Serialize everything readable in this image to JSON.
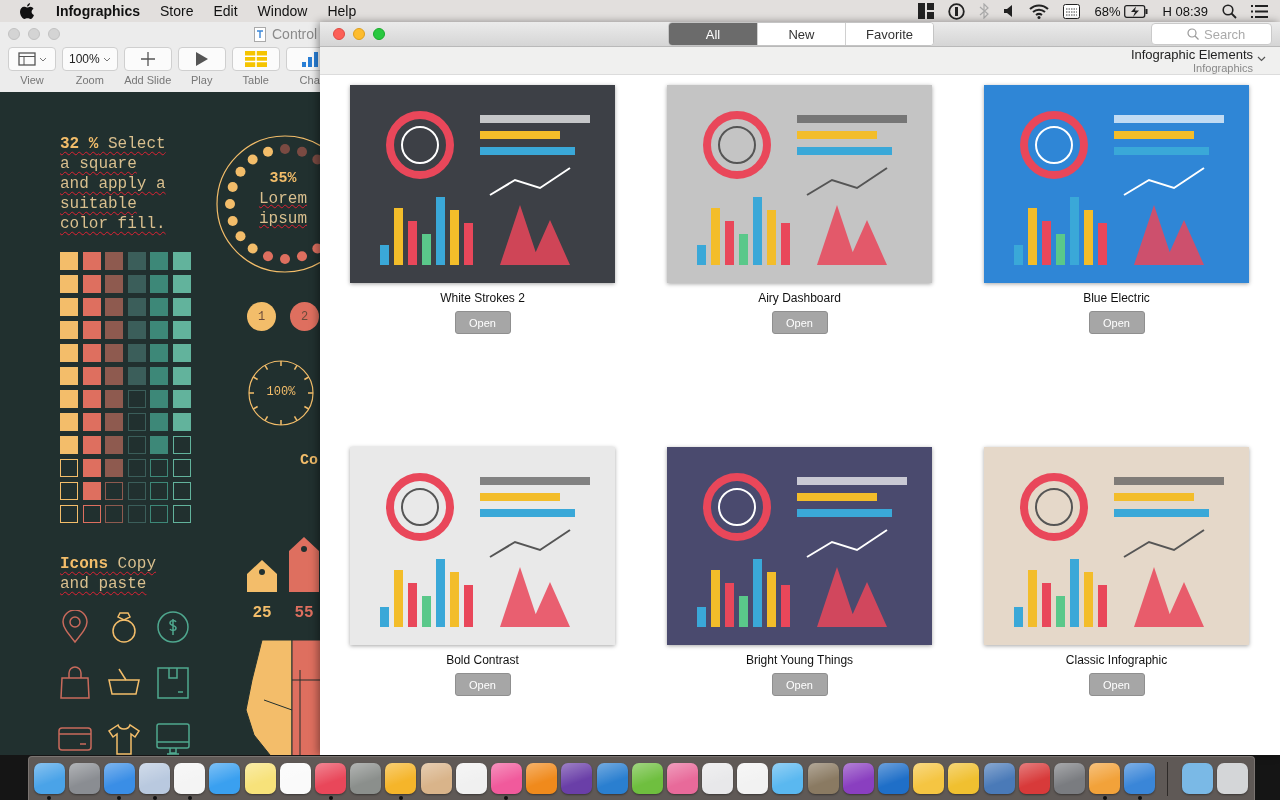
{
  "menu_bar": {
    "app_name": "Infographics",
    "menus": [
      "Store",
      "Edit",
      "Window",
      "Help"
    ],
    "battery_percent": "68%",
    "clock": "H 08:39"
  },
  "document_window": {
    "title": "Control",
    "toolbar": [
      {
        "kind": "view",
        "label": "View"
      },
      {
        "kind": "zoom",
        "label": "Zoom",
        "value": "100%"
      },
      {
        "kind": "add",
        "label": "Add Slide"
      },
      {
        "kind": "play",
        "label": "Play"
      },
      {
        "kind": "table",
        "label": "Table"
      },
      {
        "kind": "chart",
        "label": "Cha"
      }
    ],
    "canvas": {
      "intro": "**32 %** Select a square and apply a suitable color fill.",
      "swatch_columns": [
        {
          "color": "#f3bd6a",
          "level": 0.75
        },
        {
          "color": "#de6f5f",
          "level": 0.917
        },
        {
          "color": "#8e5a4f",
          "level": 0.833
        },
        {
          "color": "#3b5e5a",
          "level": 0.5
        },
        {
          "color": "#3d8878",
          "level": 0.75
        },
        {
          "color": "#62b39c",
          "level": 0.667
        }
      ],
      "icons_heading": "**Icons** Copy and paste",
      "ring_value": "35%",
      "ring_label": "Lorem ipsum",
      "steps": [
        {
          "label": "1",
          "color": "#f3bd6a"
        },
        {
          "label": "2",
          "color": "#de6f5f"
        }
      ],
      "gauge_value": "100%",
      "cut_heading": "Co",
      "tags": [
        {
          "label": "25",
          "color": "#f3bd6a"
        },
        {
          "label": "55",
          "color": "#de6f5f"
        }
      ]
    }
  },
  "template_chooser": {
    "tabs": [
      {
        "label": "All",
        "selected": true
      },
      {
        "label": "New",
        "selected": false
      },
      {
        "label": "Favorite",
        "selected": false
      }
    ],
    "search": {
      "placeholder": "Search"
    },
    "category": {
      "title": "Infographic Elements",
      "subtitle": "Infographics"
    },
    "templates": [
      {
        "name": "White Strokes 2",
        "button": "Open",
        "color": "#3d4046"
      },
      {
        "name": "Airy Dashboard",
        "button": "Open",
        "color": "#c4c4c4"
      },
      {
        "name": "Blue Electric",
        "button": "Open",
        "color": "#2f86d6"
      },
      {
        "name": "Bold Contrast",
        "button": "Open",
        "color": "#e9e9e9"
      },
      {
        "name": "Bright Young Things",
        "button": "Open",
        "color": "#4a4a6e"
      },
      {
        "name": "Classic Infographic",
        "button": "Open",
        "color": "#e5d8c9"
      }
    ]
  },
  "dock": {
    "apps": [
      {
        "color": "#4aa3e8",
        "running": true
      },
      {
        "color": "#8a8d92",
        "running": false
      },
      {
        "color": "#3a8ee6",
        "running": true
      },
      {
        "color": "#b9c9df",
        "running": true
      },
      {
        "color": "#f4f4f4",
        "running": true
      },
      {
        "color": "#3aa0f0",
        "running": false
      },
      {
        "color": "#f7e27a",
        "running": false
      },
      {
        "color": "#fafafa",
        "running": false
      },
      {
        "color": "#e9475a",
        "running": true
      },
      {
        "color": "#8b8f8c",
        "running": false
      },
      {
        "color": "#f5b52a",
        "running": true
      },
      {
        "color": "#d9b48a",
        "running": false
      },
      {
        "color": "#f0f0f0",
        "running": false
      },
      {
        "color": "#f15a9c",
        "running": true
      },
      {
        "color": "#f08a1c",
        "running": false
      },
      {
        "color": "#6a3fa8",
        "running": false
      },
      {
        "color": "#2a7fd0",
        "running": false
      },
      {
        "color": "#6fbf3f",
        "running": false
      },
      {
        "color": "#e86a9a",
        "running": false
      },
      {
        "color": "#e8e8ea",
        "running": false
      },
      {
        "color": "#f2f2f2",
        "running": false
      },
      {
        "color": "#5ab8f0",
        "running": false
      },
      {
        "color": "#8a7a62",
        "running": false
      },
      {
        "color": "#8a3fc0",
        "running": false
      },
      {
        "color": "#1f6fc8",
        "running": false
      },
      {
        "color": "#f5c542",
        "running": false
      },
      {
        "color": "#f0c030",
        "running": false
      },
      {
        "color": "#4a7ab8",
        "running": false
      },
      {
        "color": "#d83a3a",
        "running": false
      },
      {
        "color": "#7a7c80",
        "running": false
      },
      {
        "color": "#f2a23a",
        "running": true
      },
      {
        "color": "#3a86d8",
        "running": true
      }
    ],
    "stacks": [
      {
        "color": "#7ab9e6"
      },
      {
        "color": "#d4d6d8"
      }
    ]
  }
}
